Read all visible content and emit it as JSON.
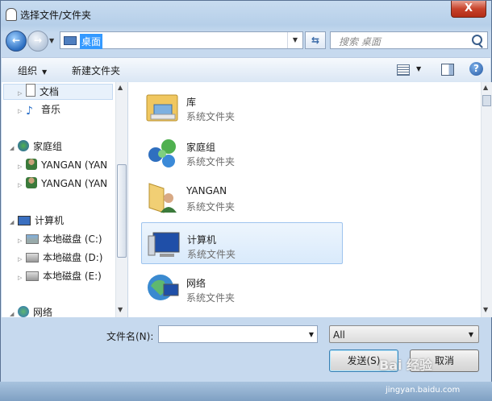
{
  "window": {
    "title": "选择文件/文件夹",
    "close_label": "X"
  },
  "navbar": {
    "address": "桌面",
    "search_placeholder": "搜索 桌面",
    "back_label": "←",
    "forward_label": "→",
    "refresh_label": "⇆"
  },
  "toolbar": {
    "organize": "组织",
    "new_folder": "新建文件夹",
    "help_label": "?"
  },
  "nav_tree": [
    {
      "label": "文档",
      "icon": "document-icon",
      "selected": true
    },
    {
      "label": "音乐",
      "icon": "music-icon"
    },
    {
      "label": "家庭组",
      "icon": "homegroup-icon"
    },
    {
      "label": "YANGAN (YAN",
      "icon": "user-icon"
    },
    {
      "label": "YANGAN (YAN",
      "icon": "user-icon"
    },
    {
      "label": "计算机",
      "icon": "computer-icon"
    },
    {
      "label": "本地磁盘 (C:)",
      "icon": "drive-icon"
    },
    {
      "label": "本地磁盘 (D:)",
      "icon": "drive-icon"
    },
    {
      "label": "本地磁盘 (E:)",
      "icon": "drive-icon"
    },
    {
      "label": "网络",
      "icon": "network-icon"
    }
  ],
  "items": [
    {
      "name": "库",
      "type": "系统文件夹",
      "icon": "library-icon"
    },
    {
      "name": "家庭组",
      "type": "系统文件夹",
      "icon": "homegroup-icon"
    },
    {
      "name": "YANGAN",
      "type": "系统文件夹",
      "icon": "user-folder-icon"
    },
    {
      "name": "计算机",
      "type": "系统文件夹",
      "icon": "computer-icon",
      "selected": true
    },
    {
      "name": "网络",
      "type": "系统文件夹",
      "icon": "network-icon"
    }
  ],
  "bottom": {
    "filename_label": "文件名(N):",
    "filename_value": "",
    "filter_value": "All",
    "send_button": "发送(S)",
    "cancel_button": "取消"
  },
  "watermark": {
    "brand": "Bai 经验",
    "url": "jingyan.baidu.com"
  }
}
